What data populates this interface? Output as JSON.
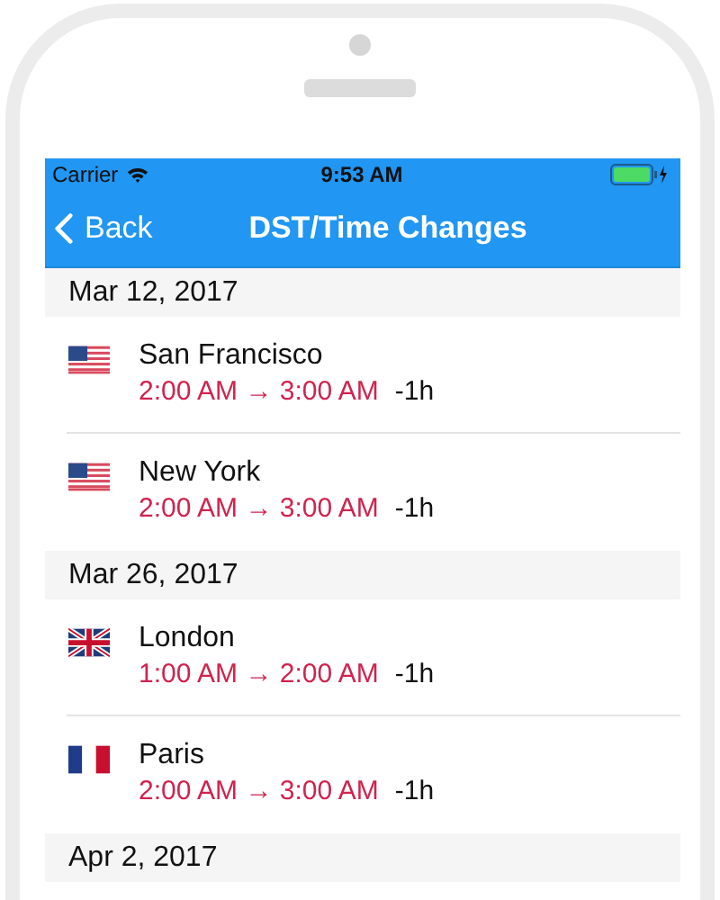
{
  "status_bar": {
    "carrier": "Carrier",
    "time": "9:53 AM"
  },
  "nav_bar": {
    "back": "Back",
    "title": "DST/Time Changes"
  },
  "sections": [
    {
      "date": "Mar 12, 2017",
      "rows": [
        {
          "kind": "us",
          "city": "San Francisco",
          "change": "2:00 AM → 3:00 AM",
          "offset": "-1h"
        },
        {
          "kind": "us",
          "city": "New York",
          "change": "2:00 AM → 3:00 AM",
          "offset": "-1h"
        }
      ]
    },
    {
      "date": "Mar 26, 2017",
      "rows": [
        {
          "kind": "uk",
          "city": "London",
          "change": "1:00 AM → 2:00 AM",
          "offset": "-1h"
        },
        {
          "kind": "fr",
          "city": "Paris",
          "change": "2:00 AM → 3:00 AM",
          "offset": "-1h"
        }
      ]
    },
    {
      "date": "Apr 2, 2017"
    }
  ]
}
